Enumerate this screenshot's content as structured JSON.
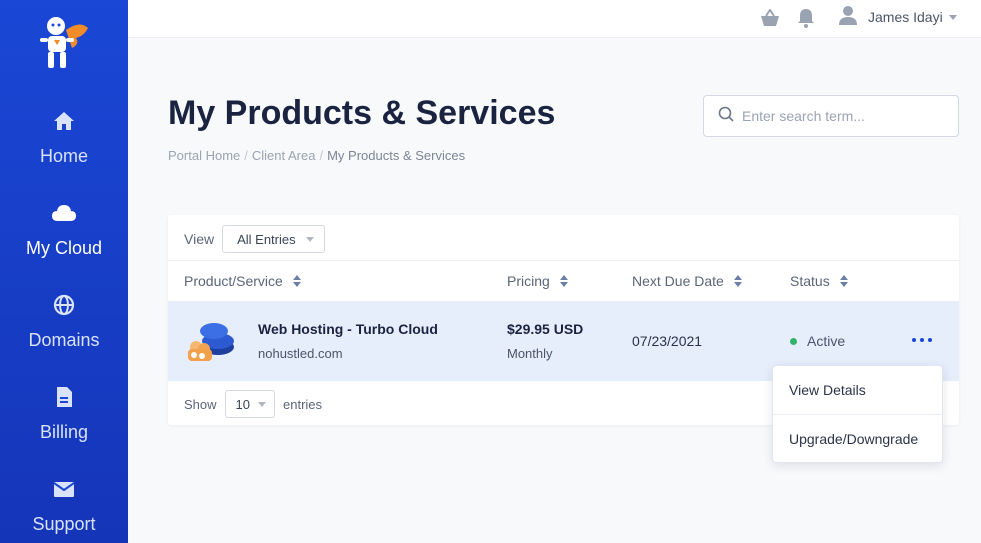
{
  "sidebar": {
    "logo": "superhero-logo",
    "items": [
      {
        "label": "Home",
        "icon": "home-icon",
        "active": false
      },
      {
        "label": "My Cloud",
        "icon": "cloud-icon",
        "active": true
      },
      {
        "label": "Domains",
        "icon": "globe-icon",
        "active": false
      },
      {
        "label": "Billing",
        "icon": "document-icon",
        "active": false
      },
      {
        "label": "Support",
        "icon": "envelope-icon",
        "active": false
      }
    ]
  },
  "topbar": {
    "icons": [
      "cart-icon",
      "bell-icon",
      "user-icon"
    ],
    "user_name": "James Idayi"
  },
  "header": {
    "title": "My Products & Services",
    "breadcrumb": [
      "Portal Home",
      "Client Area",
      "My Products & Services"
    ],
    "search_placeholder": "Enter search term..."
  },
  "table": {
    "view_label": "View",
    "view_selected": "All Entries",
    "columns": [
      "Product/Service",
      "Pricing",
      "Next Due Date",
      "Status"
    ],
    "rows": [
      {
        "product": "Web Hosting - Turbo Cloud",
        "domain": "nohustled.com",
        "price": "$29.95 USD",
        "cycle": "Monthly",
        "due": "07/23/2021",
        "status": "Active"
      }
    ],
    "show_label": "Show",
    "show_selected": "10",
    "entries_label": "entries"
  },
  "dropdown": {
    "items": [
      "View Details",
      "Upgrade/Downgrade"
    ]
  },
  "colors": {
    "sidebar": "#1a47d6",
    "row_highlight": "#e6eefc",
    "status_active": "#2fb36c",
    "accent": "#1a47d6"
  }
}
